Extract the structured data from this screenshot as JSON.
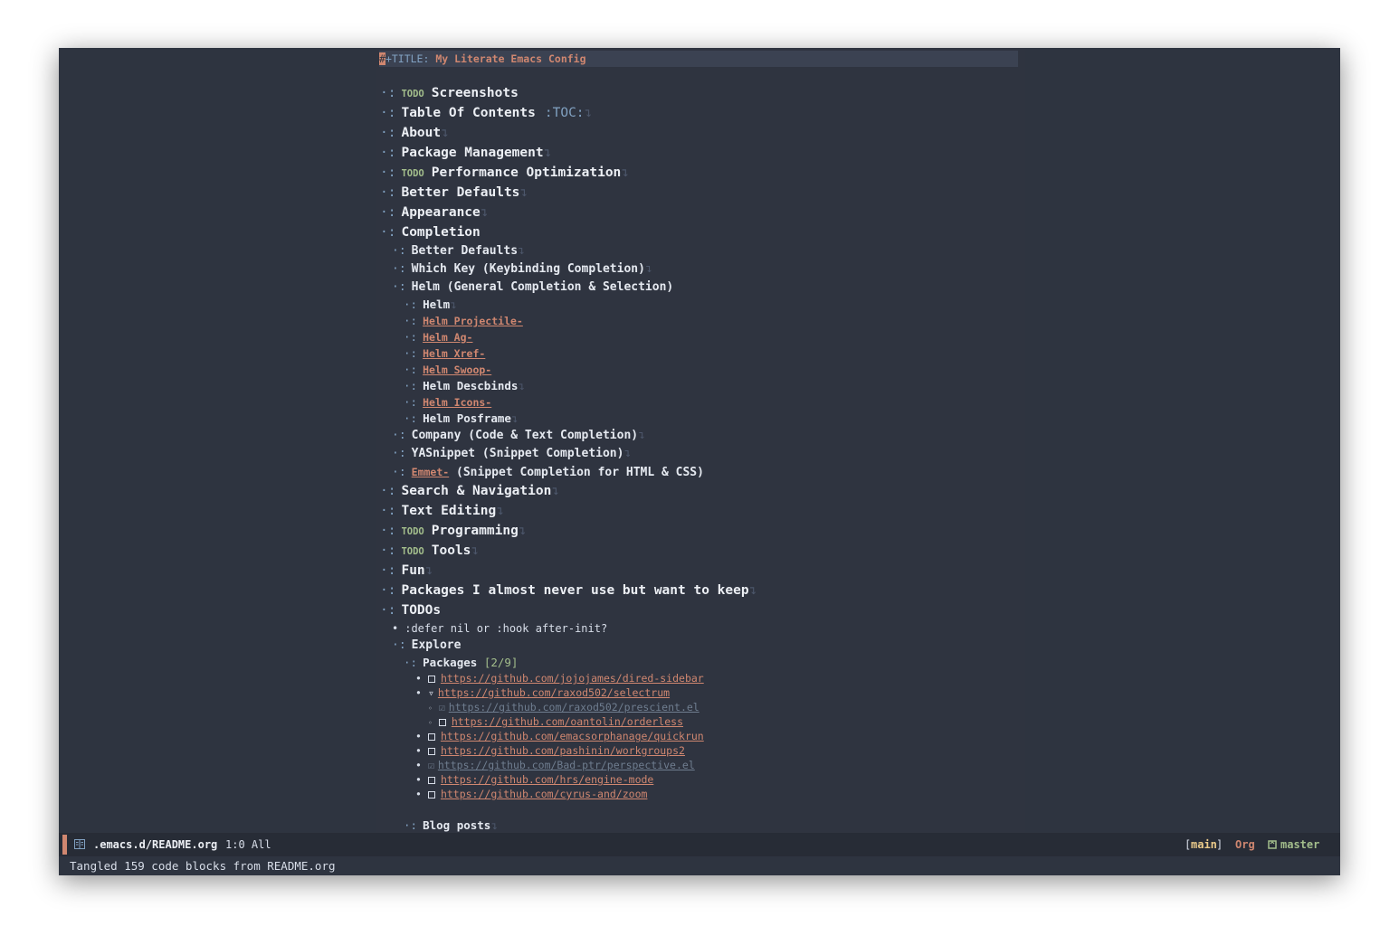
{
  "doc": {
    "title_keyword": "+TITLE:",
    "title_value": "My Literate Emacs Config",
    "cursor_char": "#",
    "star": "·:",
    "ellipsis": "↴",
    "todo": "TODO",
    "headings": {
      "screenshots": "Screenshots",
      "toc": "Table Of Contents",
      "toc_tag": ":TOC:",
      "about": "About",
      "package_management": "Package Management",
      "performance": "Performance Optimization",
      "better_defaults": "Better Defaults",
      "appearance": "Appearance",
      "completion": "Completion",
      "completion_items": {
        "better_defaults": "Better Defaults",
        "which_key": "Which Key (Keybinding Completion)",
        "helm": "Helm (General Completion & Selection)",
        "helm_items": {
          "helm": "Helm",
          "helm_projectile": "Helm Projectile-",
          "helm_ag": "Helm Ag-",
          "helm_xref": "Helm Xref-",
          "helm_swoop": "Helm Swoop-",
          "helm_descbinds": "Helm Descbinds",
          "helm_icons": "Helm Icons-",
          "helm_posframe": "Helm Posframe"
        },
        "company": "Company (Code & Text Completion)",
        "yasnippet": "YASnippet (Snippet Completion)",
        "emmet_link": "Emmet-",
        "emmet_rest": "(Snippet Completion for HTML & CSS)"
      },
      "search_navigation": "Search & Navigation",
      "text_editing": "Text Editing",
      "programming": "Programming",
      "tools": "Tools",
      "fun": "Fun",
      "packages_never": "Packages I almost never use but want to keep",
      "todos": "TODOs"
    },
    "todos_bullet": ":defer nil or :hook after-init?",
    "explore": "Explore",
    "packages": "Packages",
    "packages_count": "[2/9]",
    "check_done_glyph": "☑",
    "check_partial_glyph": "▿",
    "links": {
      "dired_sidebar": "https://github.com/jojojames/dired-sidebar",
      "selectrum": "https://github.com/raxod502/selectrum",
      "prescient": "https://github.com/raxod502/prescient.el",
      "orderless": "https://github.com/oantolin/orderless",
      "quickrun": "https://github.com/emacsorphanage/quickrun",
      "workgroups2": "https://github.com/pashinin/workgroups2",
      "perspective": "https://github.com/Bad-ptr/perspective.el",
      "engine_mode": "https://github.com/hrs/engine-mode",
      "zoom": "https://github.com/cyrus-and/zoom"
    },
    "blog_posts": "Blog posts"
  },
  "modeline": {
    "file_icon": "file-book-icon",
    "filename": ".emacs.d/README.org",
    "position": "1:0 All",
    "workspace_open": "[",
    "workspace": "main",
    "workspace_close": "]",
    "major_mode": "Org",
    "branch_icon": "git-branch-icon",
    "branch": "master"
  },
  "echo_area": "Tangled 159 code blocks from README.org",
  "colors": {
    "background": "#2e3440",
    "foreground": "#d8dee9",
    "accent": "#d08770",
    "todo": "#a3be8c",
    "keyword": "#81a1c1",
    "done": "#6f7d8f"
  }
}
